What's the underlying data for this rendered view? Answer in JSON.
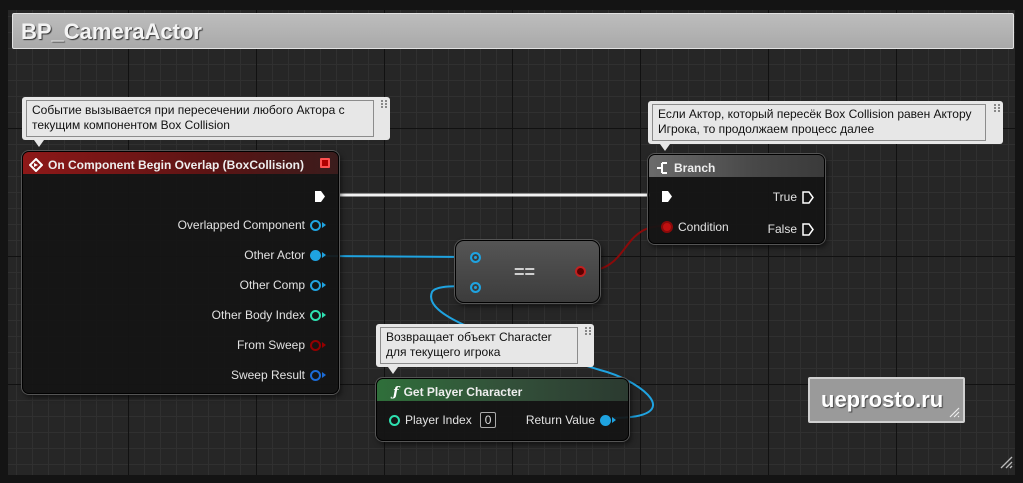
{
  "graph": {
    "title": "BP_CameraActor"
  },
  "comments": {
    "overlap": {
      "text": "Событие вызывается при пересечении любого Актора с текущим компонентом Box Collision"
    },
    "branch": {
      "text": "Если Актор, который пересёк Box Collision равен Актору Игрока, то продолжаем процесс далее"
    },
    "player": {
      "text": "Возвращает объект Character для текущего игрока"
    }
  },
  "event_node": {
    "title": "On Component Begin Overlap (BoxCollision)",
    "pins": [
      {
        "label": "Overlapped Component",
        "color": "#1fa3e0",
        "filled": false
      },
      {
        "label": "Other Actor",
        "color": "#1fa3e0",
        "filled": true
      },
      {
        "label": "Other Comp",
        "color": "#1fa3e0",
        "filled": false
      },
      {
        "label": "Other Body Index",
        "color": "#2ee0b0",
        "filled": false
      },
      {
        "label": "From Sweep",
        "color": "#950000",
        "filled": false
      },
      {
        "label": "Sweep Result",
        "color": "#1b6bd6",
        "filled": false
      }
    ],
    "icon": "event-diamond-icon",
    "delegate_icon": "red-square-icon"
  },
  "equals_node": {
    "label": "=="
  },
  "branch_node": {
    "title": "Branch",
    "icon": "branch-icon",
    "condition_label": "Condition",
    "true_label": "True",
    "false_label": "False"
  },
  "player_node": {
    "title": "Get Player Character",
    "icon": "function-icon",
    "player_index_label": "Player Index",
    "player_index_value": "0",
    "return_label": "Return Value"
  },
  "watermark": {
    "text": "ueprosto.ru"
  },
  "colors": {
    "object_pin": "#1fa3e0",
    "bool_pin": "#950000",
    "int_pin": "#2ee0b0",
    "struct_pin": "#1b6bd6",
    "exec_wire": "#ffffff"
  }
}
